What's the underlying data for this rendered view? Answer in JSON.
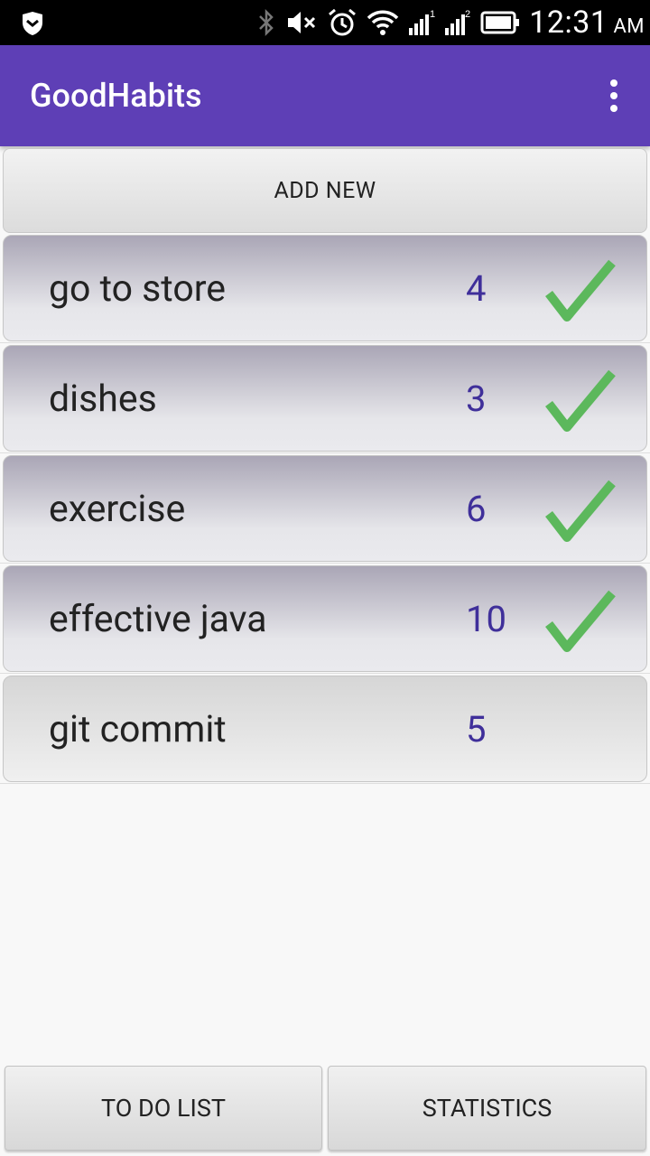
{
  "status_bar": {
    "time": "12:31",
    "ampm": "AM",
    "icons": [
      "shield-icon",
      "bluetooth-icon",
      "mute-icon",
      "alarm-icon",
      "wifi-icon",
      "signal-1-icon",
      "signal-2-icon",
      "battery-icon"
    ],
    "signal_labels": [
      "1",
      "2"
    ]
  },
  "app_bar": {
    "title": "GoodHabits",
    "menu_icon": "overflow-menu-icon",
    "color": "#5e3fb6"
  },
  "add_new_label": "ADD NEW",
  "habits": [
    {
      "name": "go to store",
      "count": "4",
      "done": true
    },
    {
      "name": "dishes",
      "count": "3",
      "done": true
    },
    {
      "name": "exercise",
      "count": "6",
      "done": true
    },
    {
      "name": "effective java",
      "count": "10",
      "done": true
    },
    {
      "name": "git commit",
      "count": "5",
      "done": false
    }
  ],
  "check_color": "#5cb85c",
  "bottom": {
    "todo_label": "TO DO LIST",
    "stats_label": "STATISTICS"
  }
}
